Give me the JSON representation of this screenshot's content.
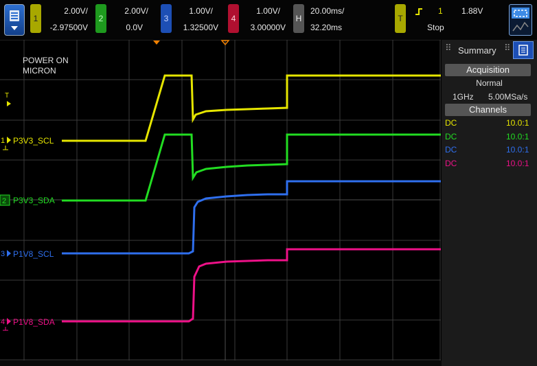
{
  "colors": {
    "ch1": "#e6e600",
    "ch2": "#22dd22",
    "ch3": "#2f6fee",
    "ch4": "#ee1188",
    "trigger": "#e6e600",
    "run_mode": "#ee2222",
    "grid": "#3a3a3a",
    "marker": "#f08000"
  },
  "menu": {
    "icon": "menu-down-icon"
  },
  "channels": [
    {
      "num": "1",
      "scale": "2.00V/",
      "offset": "-2.97500V"
    },
    {
      "num": "2",
      "scale": "2.00V/",
      "offset": "0.0V"
    },
    {
      "num": "3",
      "scale": "1.00V/",
      "offset": "1.32500V"
    },
    {
      "num": "4",
      "scale": "1.00V/",
      "offset": "3.00000V"
    }
  ],
  "horizontal": {
    "badge": "H",
    "scale": "20.00ms/",
    "position": "32.20ms"
  },
  "trigger": {
    "badge": "T",
    "slope_icon": "rising-edge-icon",
    "source": "1",
    "level": "1.88V",
    "status": "Stop"
  },
  "screen_label": {
    "line1": "POWER ON",
    "line2": "MICRON"
  },
  "trace_labels": {
    "trigger_marker": "T",
    "ch1": "P3V3_SCL",
    "ch2": "P3V3_SDA",
    "ch3": "P1V8_SCL",
    "ch4": "P1V8_SDA",
    "ch1_num": "1",
    "ch2_num": "2",
    "ch3_num": "3",
    "ch4_num": "4"
  },
  "panel": {
    "tab_title": "Summary",
    "acquisition_header": "Acquisition",
    "acq_mode": "Normal",
    "bandwidth": "1GHz",
    "sample_rate": "5.00MSa/s",
    "channels_header": "Channels",
    "channel_rows": [
      {
        "coupling": "DC",
        "probe": "10.0:1"
      },
      {
        "coupling": "DC",
        "probe": "10.0:1"
      },
      {
        "coupling": "DC",
        "probe": "10.0:1"
      },
      {
        "coupling": "DC",
        "probe": "10.0:1"
      }
    ]
  }
}
